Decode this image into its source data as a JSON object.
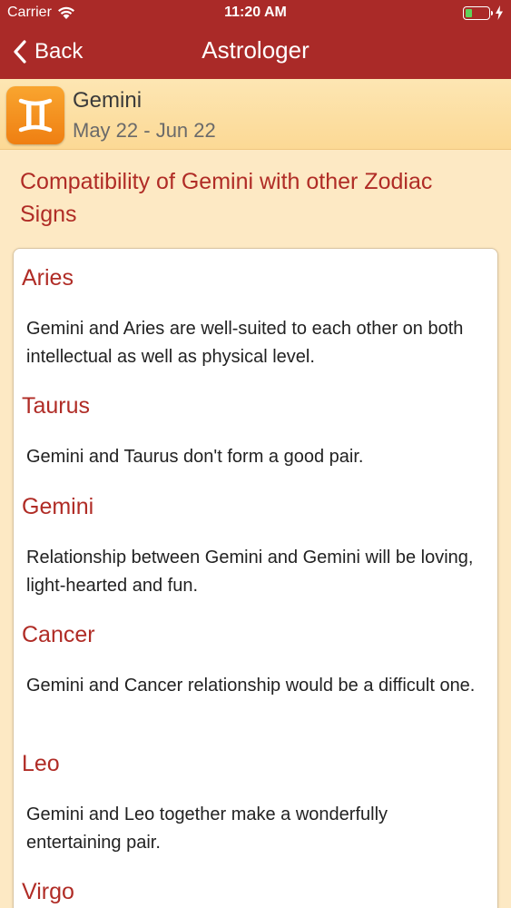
{
  "status_bar": {
    "carrier": "Carrier",
    "time": "11:20 AM"
  },
  "nav": {
    "back_label": "Back",
    "title": "Astrologer"
  },
  "sign": {
    "symbol": "gemini-symbol",
    "name": "Gemini",
    "dates": "May 22 - Jun 22"
  },
  "section": {
    "title": "Compatibility of Gemini with other Zodiac Signs"
  },
  "entries": [
    {
      "sign": "Aries",
      "text": "Gemini and Aries are well-suited to each other on both intellectual as well as physical level."
    },
    {
      "sign": "Taurus",
      "text": "Gemini and Taurus don't form a good pair."
    },
    {
      "sign": "Gemini",
      "text": "Relationship between Gemini and Gemini will be loving, light-hearted and fun."
    },
    {
      "sign": "Cancer",
      "text": "Gemini and Cancer relationship would be a difficult one."
    },
    {
      "sign": "Leo",
      "text": "Gemini and Leo together make a wonderfully entertaining pair."
    },
    {
      "sign": "Virgo",
      "text": ""
    }
  ],
  "colors": {
    "nav_bar": "#aa2a28",
    "accent_text": "#b02c26",
    "background": "#fde9c4",
    "icon_orange": "#f39420",
    "battery_green": "#5fd35a"
  }
}
